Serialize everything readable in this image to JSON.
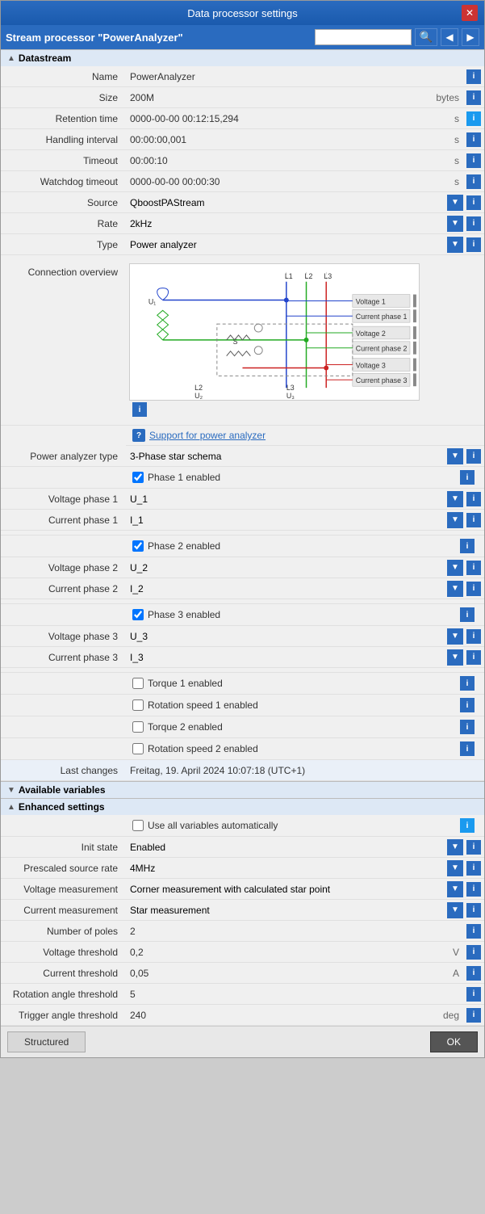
{
  "window": {
    "title": "Data processor settings",
    "stream_title": "Stream processor \"PowerAnalyzer\""
  },
  "datastream": {
    "section_label": "Datastream",
    "name_label": "Name",
    "name_value": "PowerAnalyzer",
    "size_label": "Size",
    "size_value": "200M",
    "size_unit": "bytes",
    "retention_label": "Retention time",
    "retention_value": "0000-00-00 00:12:15,294",
    "retention_unit": "s",
    "handling_label": "Handling interval",
    "handling_value": "00:00:00,001",
    "handling_unit": "s",
    "timeout_label": "Timeout",
    "timeout_value": "00:00:10",
    "timeout_unit": "s",
    "watchdog_label": "Watchdog timeout",
    "watchdog_value": "0000-00-00 00:00:30",
    "watchdog_unit": "s",
    "source_label": "Source",
    "source_value": "QboostPAStream",
    "rate_label": "Rate",
    "rate_value": "2kHz",
    "type_label": "Type",
    "type_value": "Power analyzer",
    "connection_label": "Connection overview",
    "support_text": "Support for power analyzer",
    "power_type_label": "Power analyzer type",
    "power_type_value": "3-Phase star schema",
    "phase1_check_label": "Phase 1 enabled",
    "voltage_phase1_label": "Voltage phase 1",
    "voltage_phase1_value": "U_1",
    "current_phase1_label": "Current phase 1",
    "current_phase1_value": "I_1",
    "phase2_check_label": "Phase 2 enabled",
    "voltage_phase2_label": "Voltage phase 2",
    "voltage_phase2_value": "U_2",
    "current_phase2_label": "Current phase 2",
    "current_phase2_value": "I_2",
    "phase3_check_label": "Phase 3 enabled",
    "voltage_phase3_label": "Voltage phase 3",
    "voltage_phase3_value": "U_3",
    "current_phase3_label": "Current phase 3",
    "current_phase3_value": "I_3",
    "torque1_label": "Torque 1 enabled",
    "rotation1_label": "Rotation speed 1 enabled",
    "torque2_label": "Torque 2 enabled",
    "rotation2_label": "Rotation speed 2 enabled",
    "last_changes_label": "Last changes",
    "last_changes_value": "Freitag, 19. April 2024   10:07:18 (UTC+1)"
  },
  "available_variables": {
    "section_label": "Available variables"
  },
  "enhanced_settings": {
    "section_label": "Enhanced settings",
    "use_all_label": "Use all variables automatically",
    "init_state_label": "Init state",
    "init_state_value": "Enabled",
    "prescaled_label": "Prescaled source rate",
    "prescaled_value": "4MHz",
    "voltage_meas_label": "Voltage measurement",
    "voltage_meas_value": "Corner measurement with calculated star point",
    "current_meas_label": "Current measurement",
    "current_meas_value": "Star measurement",
    "poles_label": "Number of poles",
    "poles_value": "2",
    "voltage_thresh_label": "Voltage threshold",
    "voltage_thresh_value": "0,2",
    "voltage_thresh_unit": "V",
    "current_thresh_label": "Current threshold",
    "current_thresh_value": "0,05",
    "current_thresh_unit": "A",
    "rotation_angle_label": "Rotation angle threshold",
    "rotation_angle_value": "5",
    "trigger_angle_label": "Trigger angle threshold",
    "trigger_angle_value": "240",
    "trigger_angle_unit": "deg"
  },
  "footer": {
    "structured_label": "Structured",
    "ok_label": "OK"
  }
}
